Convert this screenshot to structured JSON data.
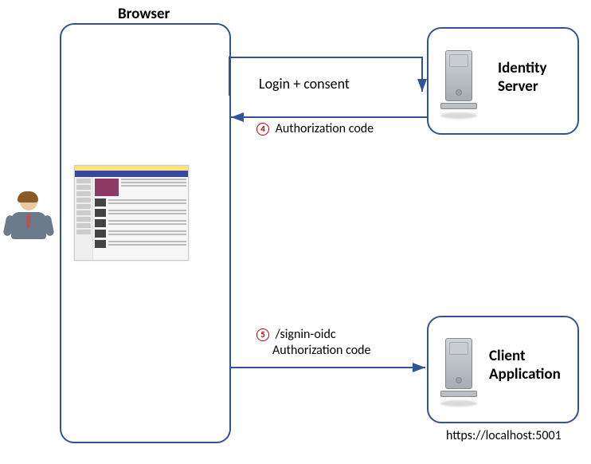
{
  "browser": {
    "title": "Browser"
  },
  "identity": {
    "title": "Identity Server"
  },
  "client": {
    "title": "Client Application",
    "url": "https://localhost:5001"
  },
  "flow": {
    "login_consent": "Login + consent",
    "step4_num": "4",
    "step4_text": "Authorization code",
    "step5_num": "5",
    "step5_line1": "/signin-oidc",
    "step5_line2": "Authorization code"
  }
}
